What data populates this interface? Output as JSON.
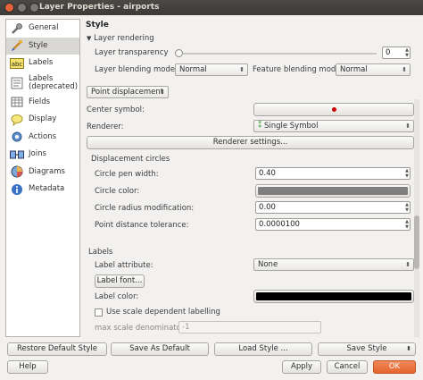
{
  "window": {
    "title": "Layer Properties - airports"
  },
  "sidebar": {
    "items": [
      {
        "label": "General",
        "icon": "wrench-icon"
      },
      {
        "label": "Style",
        "icon": "paintbrush-icon",
        "selected": true
      },
      {
        "label": "Labels",
        "icon": "abc-labels-icon"
      },
      {
        "label": "Labels (deprecated)",
        "icon": "labels-deprecated-icon"
      },
      {
        "label": "Fields",
        "icon": "table-fields-icon"
      },
      {
        "label": "Display",
        "icon": "speech-bubble-icon"
      },
      {
        "label": "Actions",
        "icon": "gear-actions-icon"
      },
      {
        "label": "Joins",
        "icon": "joins-icon"
      },
      {
        "label": "Diagrams",
        "icon": "pie-chart-icon"
      },
      {
        "label": "Metadata",
        "icon": "info-icon"
      }
    ]
  },
  "style": {
    "heading": "Style",
    "layer_rendering": "Layer rendering",
    "transparency_label": "Layer transparency",
    "transparency_value": "0",
    "transparency_level": 0,
    "blending_label": "Layer blending mode",
    "blending_value": "Normal",
    "feature_blending_label": "Feature blending mode",
    "feature_blending_value": "Normal",
    "renderer_type": "Point displacement",
    "center_symbol_label": "Center symbol:",
    "center_symbol_color": "#cc0000",
    "renderer_label": "Renderer:",
    "renderer_value": "Single Symbol",
    "renderer_settings": "Renderer settings...",
    "displacement_circles": "Displacement circles",
    "circle_pen_width_label": "Circle pen width:",
    "circle_pen_width": "0.40",
    "circle_color_label": "Circle color:",
    "circle_color": "#7f7f7f",
    "circle_radius_label": "Circle radius modification:",
    "circle_radius": "0.00",
    "point_tolerance_label": "Point distance tolerance:",
    "point_tolerance": "0.0000100",
    "labels_heading": "Labels",
    "label_attribute_label": "Label attribute:",
    "label_attribute_value": "None",
    "label_font_button": "Label font...",
    "label_color_label": "Label color:",
    "label_color": "#000000",
    "scale_dependent_label": "Use scale dependent labelling",
    "max_scale_label": "max scale denominator:",
    "max_scale_value": "-1"
  },
  "footer": {
    "restore_default": "Restore Default Style",
    "save_default": "Save As Default",
    "load_style": "Load Style ...",
    "save_style": "Save Style",
    "help": "Help",
    "apply": "Apply",
    "cancel": "Cancel",
    "ok": "OK"
  }
}
